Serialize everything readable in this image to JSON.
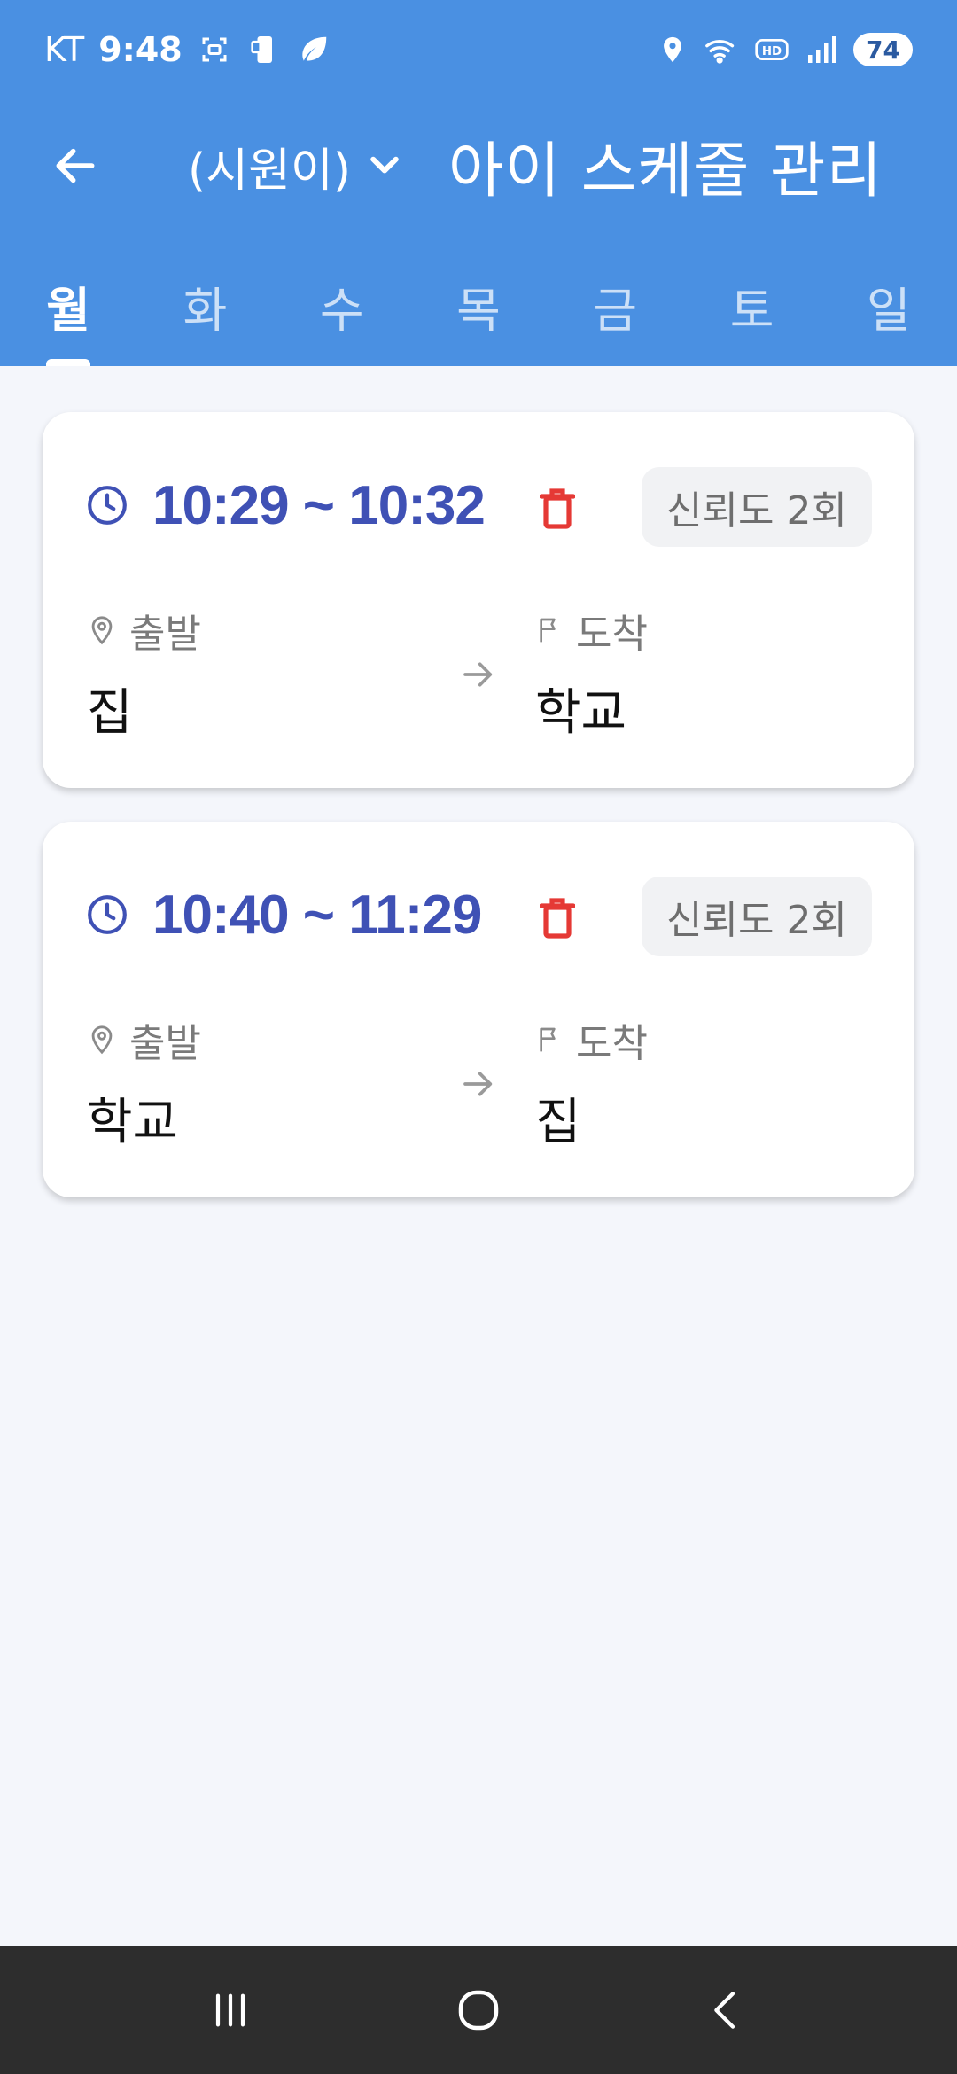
{
  "status_bar": {
    "carrier": "KT",
    "time": "9:48",
    "battery": "74",
    "icons": [
      "screenshot-icon",
      "phone-icon",
      "leaf-icon",
      "location-icon",
      "wifi-icon",
      "hd-icon",
      "signal-icon"
    ]
  },
  "app_bar": {
    "child_name": "(시원이)",
    "title": "아이 스케줄 관리"
  },
  "tabs": [
    {
      "label": "월",
      "active": true
    },
    {
      "label": "화",
      "active": false
    },
    {
      "label": "수",
      "active": false
    },
    {
      "label": "목",
      "active": false
    },
    {
      "label": "금",
      "active": false
    },
    {
      "label": "토",
      "active": false
    },
    {
      "label": "일",
      "active": false
    }
  ],
  "schedules": [
    {
      "time": "10:29 ~ 10:32",
      "reliability": "신뢰도 2회",
      "start_label": "출발",
      "start": "집",
      "end_label": "도착",
      "end": "학교"
    },
    {
      "time": "10:40 ~ 11:29",
      "reliability": "신뢰도 2회",
      "start_label": "출발",
      "start": "학교",
      "end_label": "도착",
      "end": "집"
    }
  ],
  "colors": {
    "header": "#4a90e2",
    "time_text": "#3f51b5",
    "delete": "#e53935",
    "background": "#f4f6fb",
    "nav_bar": "#2d2d2d"
  }
}
